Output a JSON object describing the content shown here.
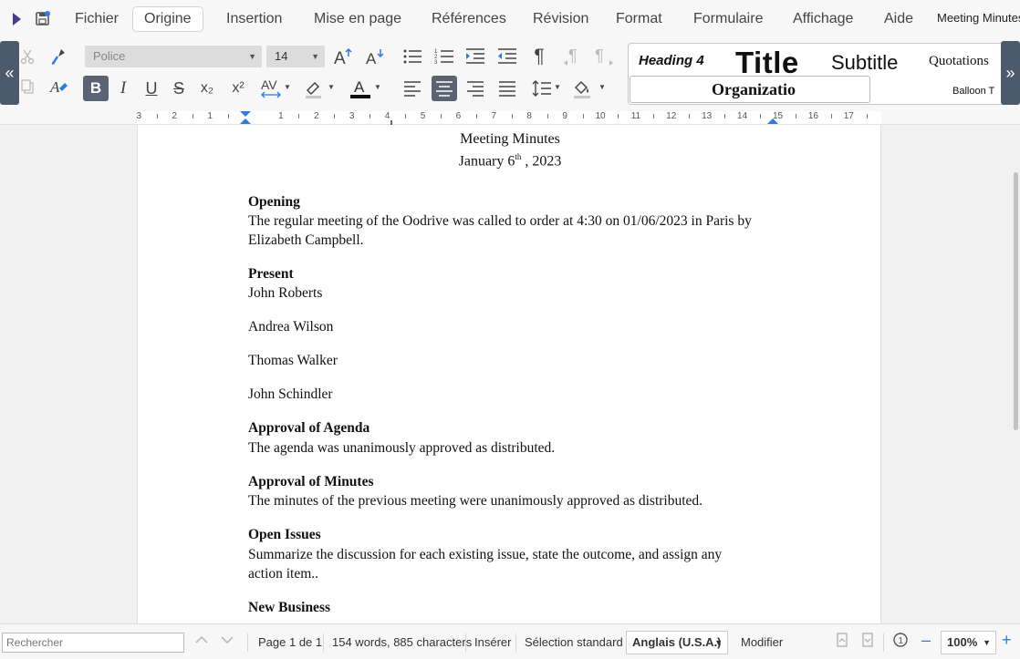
{
  "menubar": {
    "items": [
      "Fichier",
      "Origine",
      "Insertion",
      "Mise en page",
      "Références",
      "Révision",
      "Format",
      "Formulaire",
      "Affichage",
      "Aide"
    ],
    "active": "Origine",
    "document_title": "Meeting Minutes"
  },
  "ribbon": {
    "font_placeholder": "Police",
    "font_size": "14",
    "styles": {
      "heading4": "Heading 4",
      "title": "Title",
      "subtitle": "Subtitle",
      "quotations": "Quotations",
      "organization": "Organizatio",
      "balloon": "Balloon T"
    },
    "buttons": {
      "cut": "cut-icon",
      "copy": "copy-icon",
      "format_painter": "format-painter-icon",
      "clear_format": "clear-format-icon",
      "bold": "B",
      "italic": "I",
      "underline": "U",
      "strike": "S",
      "subscript": "x₂",
      "superscript": "x²",
      "grow": "A↑",
      "shrink": "A↓"
    },
    "active_buttons": [
      "bold",
      "align-center"
    ]
  },
  "ruler": {
    "labels": [
      "3",
      "2",
      "1",
      "1",
      "2",
      "3",
      "4",
      "5",
      "6",
      "7",
      "8",
      "9",
      "10",
      "11",
      "12",
      "13",
      "14",
      "15",
      "16",
      "17"
    ]
  },
  "document": {
    "header_title": "Meeting Minutes",
    "header_date_prefix": "January 6",
    "header_date_sup": "th",
    "header_date_suffix": " , 2023",
    "opening_heading": "Opening",
    "opening_line1": "The regular meeting of the Oodrive was called to order at 4:30 on 01/06/2023 in Paris by",
    "opening_line2": "Elizabeth Campbell.",
    "present_heading": "Present",
    "present": [
      "John Roberts",
      "Andrea Wilson",
      "Thomas Walker",
      "John Schindler"
    ],
    "agenda_heading": "Approval of Agenda",
    "agenda_text": "The agenda was unanimously approved as distributed.",
    "minutes_heading": "Approval of Minutes",
    "minutes_text": "The minutes of the previous meeting were unanimously approved as distributed.",
    "issues_heading": "Open Issues",
    "issues_line1": "Summarize the discussion for each existing issue, state the outcome, and assign any",
    "issues_line2": "action item..",
    "new_business_heading": "New Business"
  },
  "statusbar": {
    "search_placeholder": "Rechercher",
    "page": "Page 1 de 1",
    "counts": "154 words, 885 characters",
    "mode": "Insérer",
    "selection": "Sélection standard",
    "language": "Anglais (U.S.A.)",
    "modify": "Modifier",
    "zoom": "100%"
  }
}
